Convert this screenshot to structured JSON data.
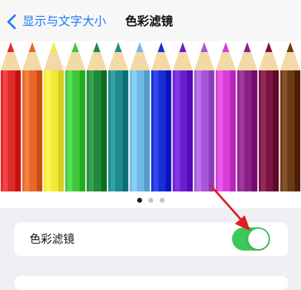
{
  "nav": {
    "back_label": "显示与文字大小",
    "title": "色彩滤镜"
  },
  "preview": {
    "pencil_colors": [
      "#e02b2b",
      "#e8682a",
      "#f1e83a",
      "#3fc63a",
      "#1f8a3a",
      "#1d8b8d",
      "#6fb8e6",
      "#1a2fd6",
      "#6b1fd0",
      "#a557d6",
      "#d43fd6",
      "#8a1f88",
      "#7a1242",
      "#6b3a16"
    ],
    "page_count": 3,
    "active_page": 0
  },
  "setting": {
    "label": "色彩滤镜",
    "enabled": true
  },
  "colors": {
    "accent": "#1a7cf5",
    "toggle_on": "#3bc85a",
    "annotation_arrow": "#e02020"
  }
}
